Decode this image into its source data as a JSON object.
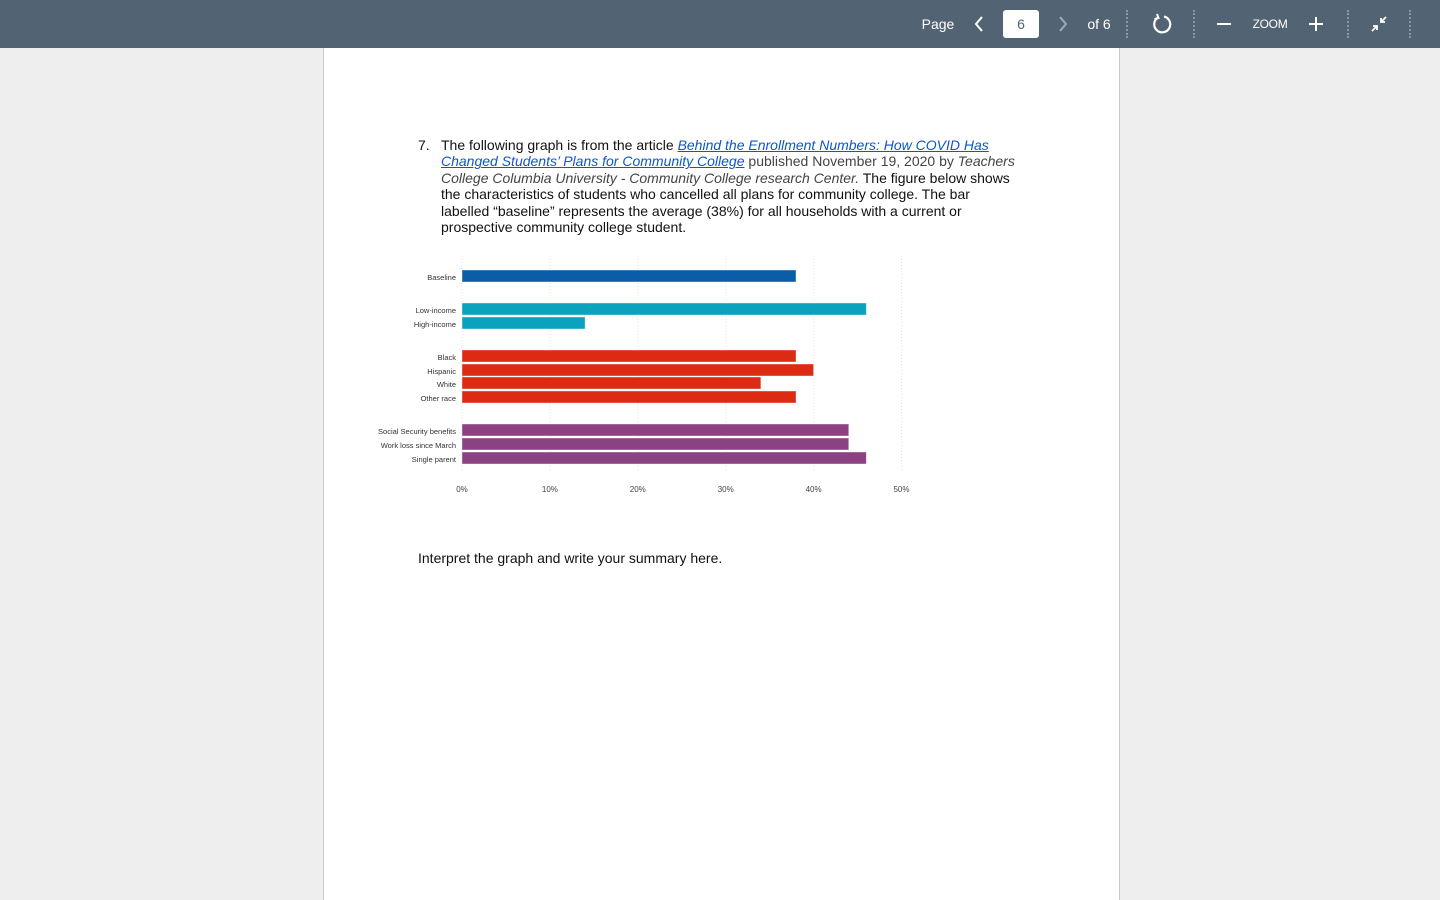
{
  "toolbar": {
    "page_label": "Page",
    "current_page": "6",
    "of_label": "of 6",
    "zoom_label": "ZOOM"
  },
  "document": {
    "question_number": "7.",
    "intro": "The following graph is from the article ",
    "article_link": "Behind the Enrollment Numbers: How COVID Has Changed Students’ Plans for Community College",
    "published": " published November 19, 2020 by ",
    "source": "Teachers College Columbia University - Community College research Center.",
    "description": "  The figure below shows the characteristics of students who cancelled all plans for community college. The bar labelled “baseline” represents the average (38%) for all households with a current or prospective community college student.",
    "summary_prompt": "Interpret the graph and write your summary here."
  },
  "chart_data": {
    "type": "bar",
    "orientation": "horizontal",
    "title": "",
    "xlabel": "",
    "ylabel": "",
    "xlim": [
      0,
      50
    ],
    "x_ticks": [
      "0%",
      "10%",
      "20%",
      "30%",
      "40%",
      "50%"
    ],
    "grid": true,
    "categories": [
      "Baseline",
      "Low-income",
      "High-income",
      "Black",
      "Hispanic",
      "White",
      "Other race",
      "Social Security benefits",
      "Work loss since March",
      "Single parent"
    ],
    "values": [
      38,
      46,
      14,
      38,
      40,
      34,
      38,
      44,
      44,
      46
    ],
    "groups": [
      0,
      1,
      1,
      2,
      2,
      2,
      2,
      3,
      3,
      3
    ],
    "group_colors": [
      "#0a5ea8",
      "#0aa2bd",
      "#dc2a13",
      "#8b4283"
    ]
  }
}
